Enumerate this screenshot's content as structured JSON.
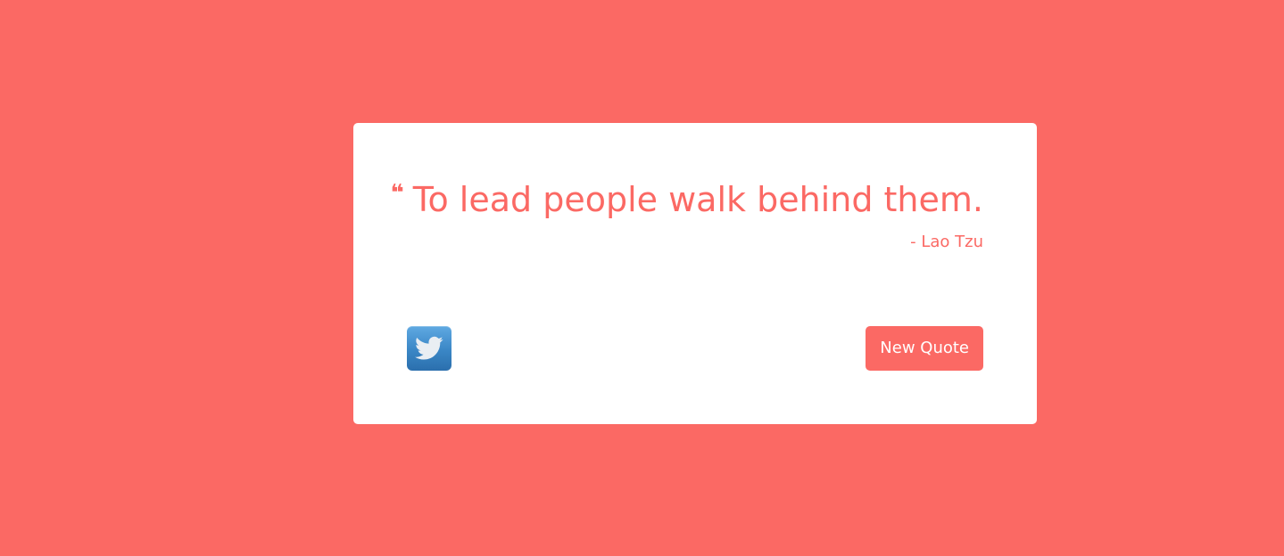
{
  "colors": {
    "background": "#fb6964",
    "card": "#ffffff",
    "accent": "#fb6964",
    "twitter_blue": "#3a86c5"
  },
  "quote": {
    "mark": "❝",
    "text": "To lead people walk behind them.",
    "author": "- Lao Tzu"
  },
  "actions": {
    "tweet_icon": "twitter-bird-icon",
    "new_quote_label": "New Quote"
  }
}
